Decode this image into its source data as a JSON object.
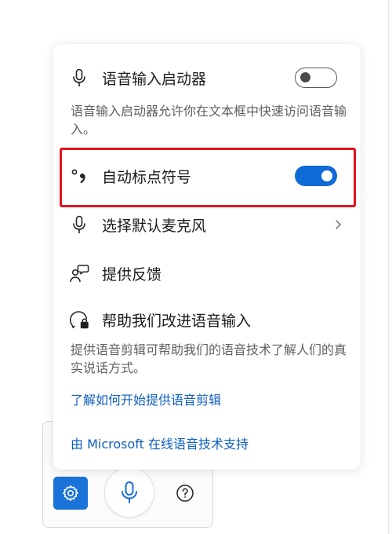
{
  "panel": {
    "voice_launcher": {
      "label": "语音输入启动器",
      "enabled": false
    },
    "voice_launcher_desc": "语音输入启动器允许你在文本框中快速访问语音输入。",
    "auto_punctuation": {
      "label": "自动标点符号",
      "enabled": true
    },
    "default_mic": {
      "label": "选择默认麦克风"
    },
    "feedback": {
      "label": "提供反馈"
    },
    "improve": {
      "label": "帮助我们改进语音输入"
    },
    "improve_desc": "提供语音剪辑可帮助我们的语音技术了解人们的真实说话方式。",
    "learn_link": "了解如何开始提供语音剪辑",
    "powered_by_link": "由 Microsoft 在线语音技术支持"
  },
  "toolbar": {
    "settings_icon": "gear-icon",
    "mic_icon": "microphone-icon",
    "help_icon": "question-icon"
  },
  "colors": {
    "accent": "#0f6bd6",
    "highlight": "#e0141e",
    "link": "#0f5fbf"
  }
}
